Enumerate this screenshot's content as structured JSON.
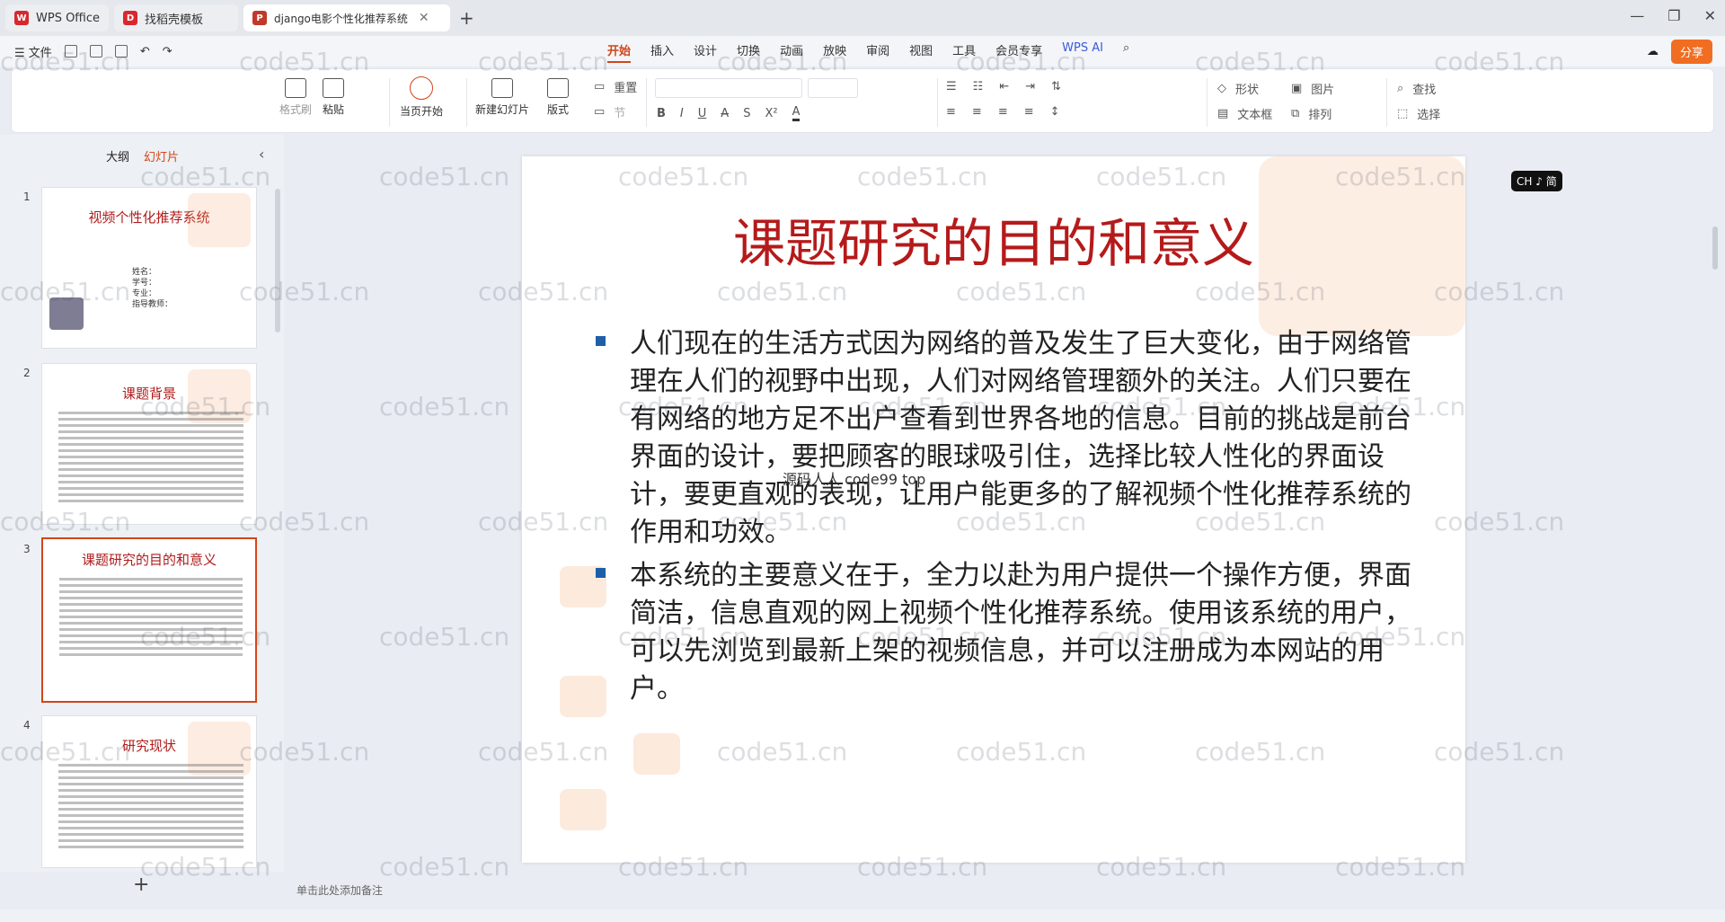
{
  "titlebar": {
    "tabs": [
      {
        "label": "WPS Office",
        "logo": "W",
        "color": "#d9272e"
      },
      {
        "label": "找稻壳模板",
        "logo": "D",
        "color": "#d9272e"
      },
      {
        "label": "django电影个性化推荐系统",
        "logo": "P",
        "color": "#c0392b"
      }
    ],
    "new_tab": "+"
  },
  "menubar": {
    "file": "文件",
    "tabs": [
      "开始",
      "插入",
      "设计",
      "切换",
      "动画",
      "放映",
      "审阅",
      "视图",
      "工具",
      "会员专享"
    ],
    "wps_ai": "WPS AI",
    "share": "分享"
  },
  "ribbon": {
    "format_painter": "格式刷",
    "paste": "粘贴",
    "play_from_current": "当页开始",
    "new_slide": "新建幻灯片",
    "layout": "版式",
    "reset": "重置",
    "section": "节",
    "shape": "形状",
    "picture": "图片",
    "find": "查找",
    "textbox": "文本框",
    "arrange": "排列",
    "select": "选择"
  },
  "left_panel": {
    "tab_outline": "大纲",
    "tab_slides": "幻灯片",
    "slides": [
      {
        "num": "1",
        "title": "视频个性化推荐系统",
        "info": [
          "姓名：",
          "学号：",
          "专业：",
          "指导教师："
        ]
      },
      {
        "num": "2",
        "title": "课题背景"
      },
      {
        "num": "3",
        "title": "课题研究的目的和意义"
      },
      {
        "num": "4",
        "title": "研究现状"
      }
    ],
    "add": "+"
  },
  "slide": {
    "title": "课题研究的目的和意义",
    "paragraphs": [
      "人们现在的生活方式因为网络的普及发生了巨大变化，由于网络管理在人们的视野中出现，人们对网络管理额外的关注。人们只要在有网络的地方足不出户查看到世界各地的信息。目前的挑战是前台界面的设计，要把顾客的眼球吸引住，选择比较人性化的界面设计，要更直观的表现，让用户能更多的了解视频个性化推荐系统的作用和功效。",
      "本系统的主要意义在于，全力以赴为用户提供一个操作方便，界面简洁，信息直观的网上视频个性化推荐系统。使用该系统的用户，可以先浏览到最新上架的视频信息，并可以注册成为本网站的用户。"
    ],
    "overlay": "源码人人 code99 top"
  },
  "notes_placeholder": "单击此处添加备注",
  "lang_badge": "CH ♪ 简",
  "watermark": "code51.cn"
}
